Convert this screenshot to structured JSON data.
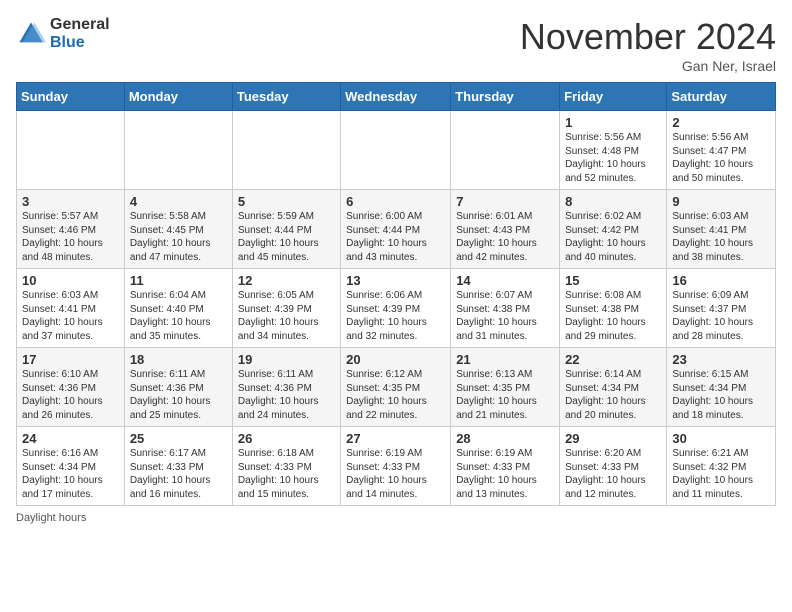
{
  "header": {
    "logo_general": "General",
    "logo_blue": "Blue",
    "month_title": "November 2024",
    "location": "Gan Ner, Israel"
  },
  "weekdays": [
    "Sunday",
    "Monday",
    "Tuesday",
    "Wednesday",
    "Thursday",
    "Friday",
    "Saturday"
  ],
  "weeks": [
    [
      {
        "day": "",
        "info": ""
      },
      {
        "day": "",
        "info": ""
      },
      {
        "day": "",
        "info": ""
      },
      {
        "day": "",
        "info": ""
      },
      {
        "day": "",
        "info": ""
      },
      {
        "day": "1",
        "info": "Sunrise: 5:56 AM\nSunset: 4:48 PM\nDaylight: 10 hours and 52 minutes."
      },
      {
        "day": "2",
        "info": "Sunrise: 5:56 AM\nSunset: 4:47 PM\nDaylight: 10 hours and 50 minutes."
      }
    ],
    [
      {
        "day": "3",
        "info": "Sunrise: 5:57 AM\nSunset: 4:46 PM\nDaylight: 10 hours and 48 minutes."
      },
      {
        "day": "4",
        "info": "Sunrise: 5:58 AM\nSunset: 4:45 PM\nDaylight: 10 hours and 47 minutes."
      },
      {
        "day": "5",
        "info": "Sunrise: 5:59 AM\nSunset: 4:44 PM\nDaylight: 10 hours and 45 minutes."
      },
      {
        "day": "6",
        "info": "Sunrise: 6:00 AM\nSunset: 4:44 PM\nDaylight: 10 hours and 43 minutes."
      },
      {
        "day": "7",
        "info": "Sunrise: 6:01 AM\nSunset: 4:43 PM\nDaylight: 10 hours and 42 minutes."
      },
      {
        "day": "8",
        "info": "Sunrise: 6:02 AM\nSunset: 4:42 PM\nDaylight: 10 hours and 40 minutes."
      },
      {
        "day": "9",
        "info": "Sunrise: 6:03 AM\nSunset: 4:41 PM\nDaylight: 10 hours and 38 minutes."
      }
    ],
    [
      {
        "day": "10",
        "info": "Sunrise: 6:03 AM\nSunset: 4:41 PM\nDaylight: 10 hours and 37 minutes."
      },
      {
        "day": "11",
        "info": "Sunrise: 6:04 AM\nSunset: 4:40 PM\nDaylight: 10 hours and 35 minutes."
      },
      {
        "day": "12",
        "info": "Sunrise: 6:05 AM\nSunset: 4:39 PM\nDaylight: 10 hours and 34 minutes."
      },
      {
        "day": "13",
        "info": "Sunrise: 6:06 AM\nSunset: 4:39 PM\nDaylight: 10 hours and 32 minutes."
      },
      {
        "day": "14",
        "info": "Sunrise: 6:07 AM\nSunset: 4:38 PM\nDaylight: 10 hours and 31 minutes."
      },
      {
        "day": "15",
        "info": "Sunrise: 6:08 AM\nSunset: 4:38 PM\nDaylight: 10 hours and 29 minutes."
      },
      {
        "day": "16",
        "info": "Sunrise: 6:09 AM\nSunset: 4:37 PM\nDaylight: 10 hours and 28 minutes."
      }
    ],
    [
      {
        "day": "17",
        "info": "Sunrise: 6:10 AM\nSunset: 4:36 PM\nDaylight: 10 hours and 26 minutes."
      },
      {
        "day": "18",
        "info": "Sunrise: 6:11 AM\nSunset: 4:36 PM\nDaylight: 10 hours and 25 minutes."
      },
      {
        "day": "19",
        "info": "Sunrise: 6:11 AM\nSunset: 4:36 PM\nDaylight: 10 hours and 24 minutes."
      },
      {
        "day": "20",
        "info": "Sunrise: 6:12 AM\nSunset: 4:35 PM\nDaylight: 10 hours and 22 minutes."
      },
      {
        "day": "21",
        "info": "Sunrise: 6:13 AM\nSunset: 4:35 PM\nDaylight: 10 hours and 21 minutes."
      },
      {
        "day": "22",
        "info": "Sunrise: 6:14 AM\nSunset: 4:34 PM\nDaylight: 10 hours and 20 minutes."
      },
      {
        "day": "23",
        "info": "Sunrise: 6:15 AM\nSunset: 4:34 PM\nDaylight: 10 hours and 18 minutes."
      }
    ],
    [
      {
        "day": "24",
        "info": "Sunrise: 6:16 AM\nSunset: 4:34 PM\nDaylight: 10 hours and 17 minutes."
      },
      {
        "day": "25",
        "info": "Sunrise: 6:17 AM\nSunset: 4:33 PM\nDaylight: 10 hours and 16 minutes."
      },
      {
        "day": "26",
        "info": "Sunrise: 6:18 AM\nSunset: 4:33 PM\nDaylight: 10 hours and 15 minutes."
      },
      {
        "day": "27",
        "info": "Sunrise: 6:19 AM\nSunset: 4:33 PM\nDaylight: 10 hours and 14 minutes."
      },
      {
        "day": "28",
        "info": "Sunrise: 6:19 AM\nSunset: 4:33 PM\nDaylight: 10 hours and 13 minutes."
      },
      {
        "day": "29",
        "info": "Sunrise: 6:20 AM\nSunset: 4:33 PM\nDaylight: 10 hours and 12 minutes."
      },
      {
        "day": "30",
        "info": "Sunrise: 6:21 AM\nSunset: 4:32 PM\nDaylight: 10 hours and 11 minutes."
      }
    ]
  ],
  "footer": {
    "daylight_label": "Daylight hours"
  }
}
